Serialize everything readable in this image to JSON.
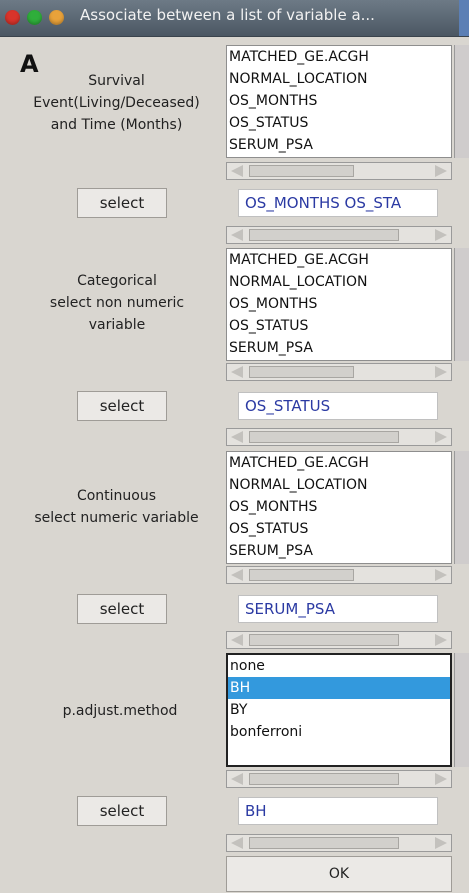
{
  "window": {
    "title": "Associate between a list of variable a..."
  },
  "panel_label": "A",
  "sections": {
    "survival": {
      "label_lines": [
        "Survival",
        "Event(Living/Deceased)",
        "and Time (Months)"
      ],
      "items": [
        "MATCHED_GE.ACGH",
        "NORMAL_LOCATION",
        "OS_MONTHS",
        "OS_STATUS",
        "SERUM_PSA"
      ],
      "button": "select",
      "value": "OS_MONTHS OS_STA"
    },
    "categorical": {
      "label_lines": [
        "Categorical",
        "select non numeric",
        "variable"
      ],
      "items": [
        "MATCHED_GE.ACGH",
        "NORMAL_LOCATION",
        "OS_MONTHS",
        "OS_STATUS",
        "SERUM_PSA"
      ],
      "button": "select",
      "value": "OS_STATUS"
    },
    "continuous": {
      "label_lines": [
        "Continuous",
        "select numeric variable"
      ],
      "items": [
        "MATCHED_GE.ACGH",
        "NORMAL_LOCATION",
        "OS_MONTHS",
        "OS_STATUS",
        "SERUM_PSA"
      ],
      "button": "select",
      "value": "SERUM_PSA"
    },
    "padjust": {
      "label": "p.adjust.method",
      "items": [
        "none",
        "BH",
        "BY",
        "bonferroni"
      ],
      "selected": "BH",
      "button": "select",
      "value": "BH"
    }
  },
  "ok_button": "OK"
}
